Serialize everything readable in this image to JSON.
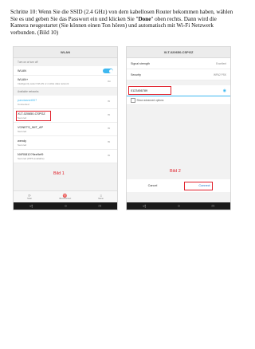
{
  "instruction": {
    "prefix": "Schritte 10: Wenn Sie die SSID (2.4 GHz) von dem kabellosen Router bekommen haben, wählen Sie es und geben Sie das Passwort ein und klicken Sie \"",
    "bold": "Done",
    "suffix": "\" oben rechts. Dann wird die Kamera neugestartet (Sie können einen Ton hören) und automatisch mit Wi-Fi Netzwerk verbunden. (Bild 10)"
  },
  "screen1": {
    "title": "WLAN",
    "section_toggle": "Turn on or turn off",
    "wlan_label": "WLAN",
    "wlanplus_label": "WLAN+",
    "wlanplus_sub": "Intelligently select WLAN or mobile data network",
    "wlanplus_state": "On",
    "section_networks": "Available networks",
    "networks": [
      {
        "name": "pandaanet007",
        "status": "Connected"
      },
      {
        "name": "XLT-020650-CSPGZ",
        "status": "Secured"
      },
      {
        "name": "VONETS_INIT_AP",
        "status": "Secured"
      },
      {
        "name": "wendy",
        "status": "Secured"
      },
      {
        "name": "NVR0810?9ee9ef9",
        "status": "Secured (WPS available)"
      }
    ],
    "caption": "Bild 1",
    "bottom": [
      "Scan",
      "WLAN Direct",
      "Menu"
    ]
  },
  "screen2": {
    "title": "XLT-020650-CSPGZ",
    "signal_label": "Signal strength",
    "signal_value": "Excellent",
    "security_label": "Security",
    "security_value": "WPA2 PSK",
    "password": "0123456789",
    "show_advanced": "Show advanced options",
    "caption": "Bild 2",
    "cancel": "Cancel",
    "connect": "Connect"
  },
  "colors": {
    "accent": "#3eb8f0",
    "highlight": "#e0202a"
  }
}
